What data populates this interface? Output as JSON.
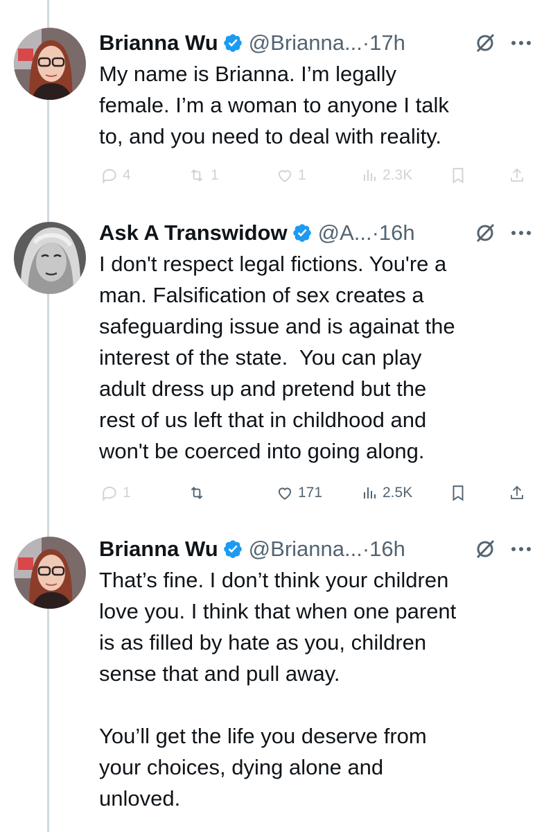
{
  "tweets": [
    {
      "name": "Brianna Wu",
      "handle": "@Brianna...",
      "dot": "·",
      "time": "17h",
      "body": "My name is Brianna. I’m legally\nfemale. I’m a woman to anyone I talk\nto, and you need to deal with reality.",
      "replies": "4",
      "reposts": "1",
      "likes": "1",
      "views": "2.3K"
    },
    {
      "name": "Ask A Transwidow",
      "handle": "@A...",
      "dot": "·",
      "time": "16h",
      "body": "I don't respect legal fictions. You're a\nman. Falsification of sex creates a\nsafeguarding issue and is againat the\ninterest of the state.  You can play\nadult dress up and pretend but the\nrest of us left that in childhood and\nwon't be coerced into going along.",
      "replies": "1",
      "reposts": "",
      "likes": "171",
      "views": "2.5K"
    },
    {
      "name": "Brianna Wu",
      "handle": "@Brianna...",
      "dot": "·",
      "time": "16h",
      "body": "That’s fine. I don’t think your children\nlove you. I think that when one parent\nis as filled by hate as you, children\nsense that and pull away.\n\nYou’ll get the life you deserve from\nyour choices, dying alone and\nunloved."
    }
  ],
  "colors": {
    "verified": "#1d9bf0",
    "text": "#0f1419",
    "secondary": "#536471",
    "thread_line": "#cfd9de"
  }
}
